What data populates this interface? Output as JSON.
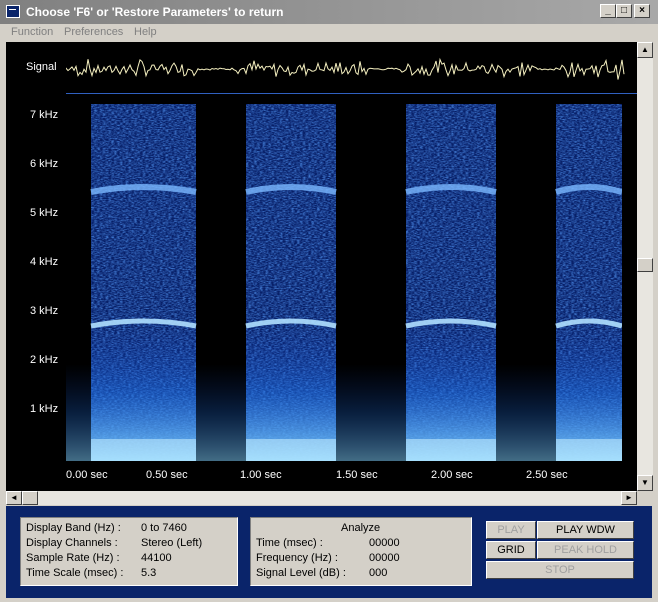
{
  "window": {
    "title": "Choose 'F6' or 'Restore Parameters' to return",
    "min_glyph": "_",
    "max_glyph": "□",
    "close_glyph": "×"
  },
  "menu": [
    "Function",
    "Preferences",
    "Help"
  ],
  "signal_label": "Signal",
  "freq_ticks": [
    "7 kHz",
    "6 kHz",
    "5 kHz",
    "4 kHz",
    "3 kHz",
    "2 kHz",
    "1 kHz"
  ],
  "time_ticks": [
    "0.00 sec",
    "0.50 sec",
    "1.00 sec",
    "1.50 sec",
    "2.00 sec",
    "2.50 sec"
  ],
  "scroll_glyphs": {
    "up": "▲",
    "down": "▼",
    "left": "◄",
    "right": "►"
  },
  "info": {
    "band_label": "Display Band (Hz) :",
    "band_value": "0 to 7460",
    "channels_label": "Display Channels :",
    "channels_value": "Stereo (Left)",
    "rate_label": "Sample Rate (Hz) :",
    "rate_value": "44100",
    "scale_label": "Time Scale (msec) :",
    "scale_value": "5.3"
  },
  "analyze": {
    "title": "Analyze",
    "time_label": "Time (msec) :",
    "time_value": "00000",
    "freq_label": "Frequency (Hz) :",
    "freq_value": "00000",
    "level_label": "Signal Level (dB) :",
    "level_value": "000"
  },
  "buttons": {
    "play": "PLAY",
    "play_wdw": "PLAY WDW",
    "grid": "GRID",
    "peak_hold": "PEAK HOLD",
    "stop": "STOP"
  },
  "colors": {
    "spectrogram_low": "#0a2a8a",
    "spectrogram_mid": "#1a6aff",
    "spectrogram_high": "#9ad8ff",
    "panel_bg": "#0a246a",
    "waveform": "#f5f0c0"
  }
}
